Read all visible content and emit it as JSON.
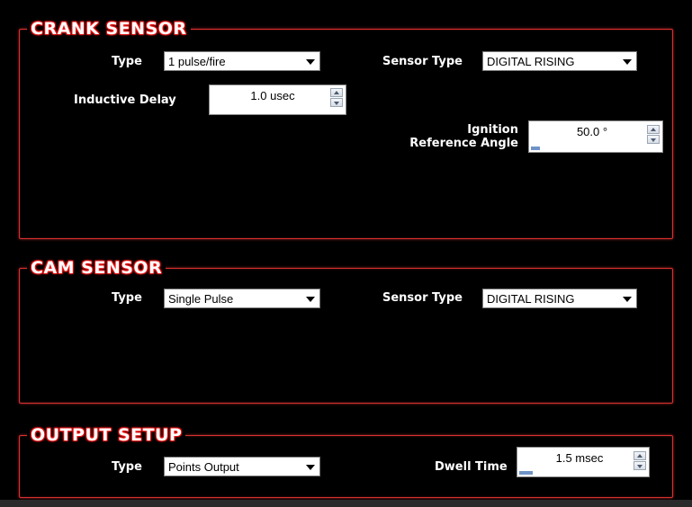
{
  "crank": {
    "title": "CRANK SENSOR",
    "type_label": "Type",
    "type_value": "1 pulse/fire",
    "sensor_type_label": "Sensor Type",
    "sensor_type_value": "DIGITAL RISING",
    "inductive_delay_label": "Inductive Delay",
    "inductive_delay_value": "1.0 usec",
    "ignition_ref_label_line1": "Ignition",
    "ignition_ref_label_line2": "Reference Angle",
    "ignition_ref_value": "50.0 °",
    "ignition_ref_level": 0.08
  },
  "cam": {
    "title": "CAM SENSOR",
    "type_label": "Type",
    "type_value": "Single Pulse",
    "sensor_type_label": "Sensor Type",
    "sensor_type_value": "DIGITAL RISING"
  },
  "output": {
    "title": "OUTPUT SETUP",
    "type_label": "Type",
    "type_value": "Points Output",
    "dwell_label": "Dwell Time",
    "dwell_value": "1.5 msec",
    "dwell_level": 0.12
  },
  "icons": {
    "dropdown": "chevron-down-icon",
    "spin_up": "arrow-up-icon",
    "spin_down": "arrow-down-icon"
  },
  "colors": {
    "frame": "#d93030",
    "background": "#000000",
    "level_bar": "#6f93c6"
  }
}
